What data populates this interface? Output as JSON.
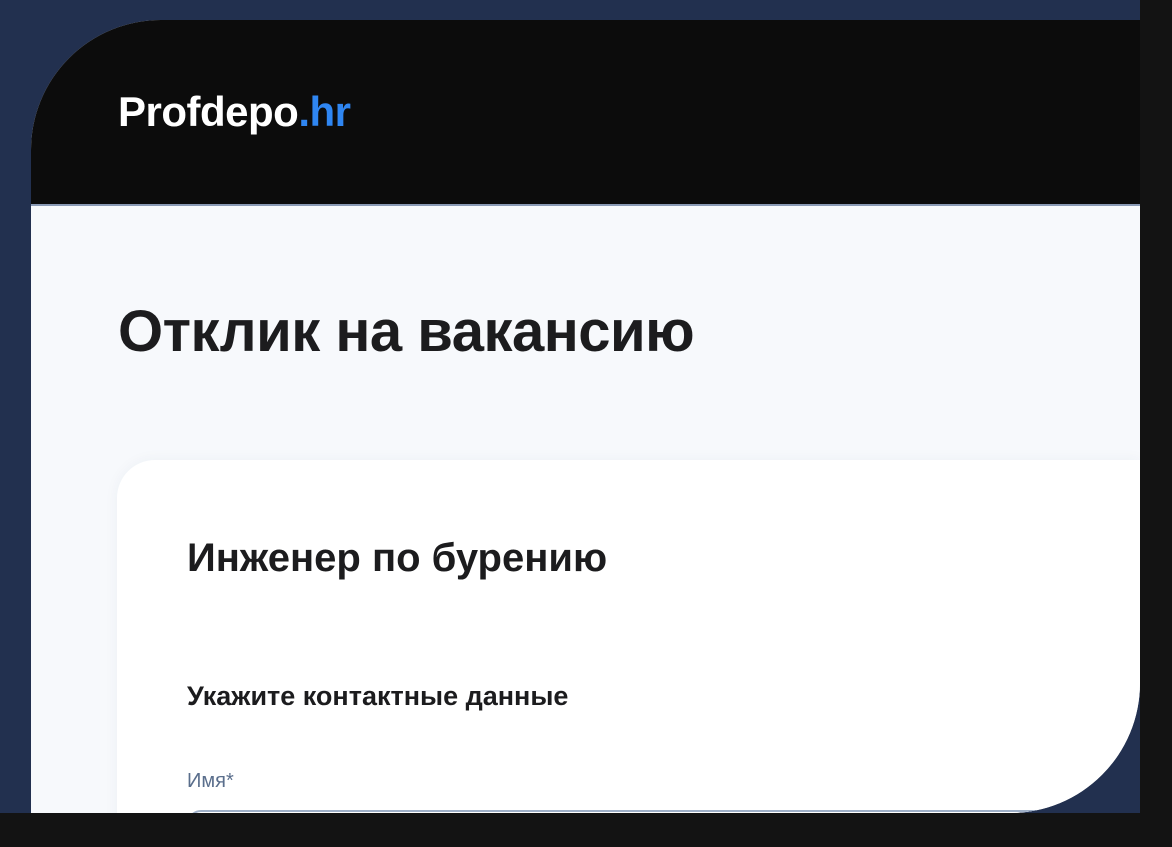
{
  "header": {
    "logo_main": "Profdepo",
    "logo_accent": ".hr"
  },
  "page": {
    "title": "Отклик на вакансию"
  },
  "form": {
    "vacancy_title": "Инженер по бурению",
    "section_heading": "Укажите контактные данные",
    "name_field": {
      "label": "Имя*",
      "value": "",
      "placeholder": ""
    }
  },
  "colors": {
    "accent": "#2f86f2",
    "header_bg": "#0c0c0c",
    "page_bg": "#f7f9fc",
    "frame": "#22304f",
    "label": "#5a6e8c"
  }
}
